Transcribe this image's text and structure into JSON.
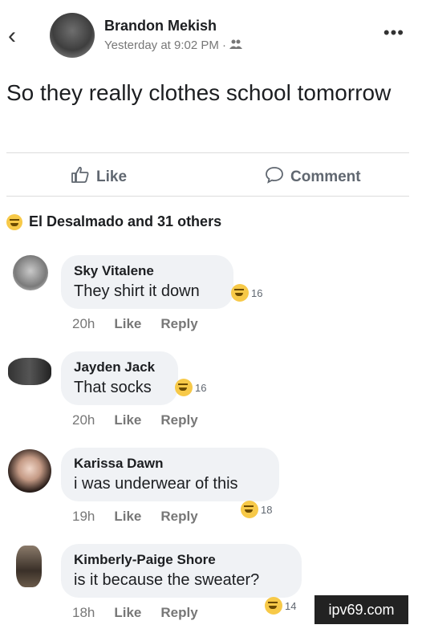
{
  "post": {
    "author": "Brandon Mekish",
    "timestamp": "Yesterday at 9:02 PM ·",
    "text": "So they really clothes school tomorrow"
  },
  "actions": {
    "like_label": "Like",
    "comment_label": "Comment"
  },
  "reactions": {
    "summary": "El Desalmado and 31 others"
  },
  "comments": [
    {
      "name": "Sky Vitalene",
      "text": "They shirt it down",
      "time": "20h",
      "like": "Like",
      "reply": "Reply",
      "reaction_count": "16"
    },
    {
      "name": "Jayden Jack",
      "text": "That socks",
      "time": "20h",
      "like": "Like",
      "reply": "Reply",
      "reaction_count": "16"
    },
    {
      "name": "Karissa Dawn",
      "text": "i was underwear of this",
      "time": "19h",
      "like": "Like",
      "reply": "Reply",
      "reaction_count": "18"
    },
    {
      "name": "Kimberly-Paige Shore",
      "text": "is it because the sweater?",
      "time": "18h",
      "like": "Like",
      "reply": "Reply",
      "reaction_count": "14"
    }
  ],
  "watermark": "ipv69.com",
  "icons": {
    "back": "back-chevron-icon",
    "more": "more-dots-icon",
    "like": "thumbs-up-icon",
    "comment": "comment-bubble-icon",
    "audience": "friends-icon",
    "reaction": "laughing-emoji-icon"
  }
}
